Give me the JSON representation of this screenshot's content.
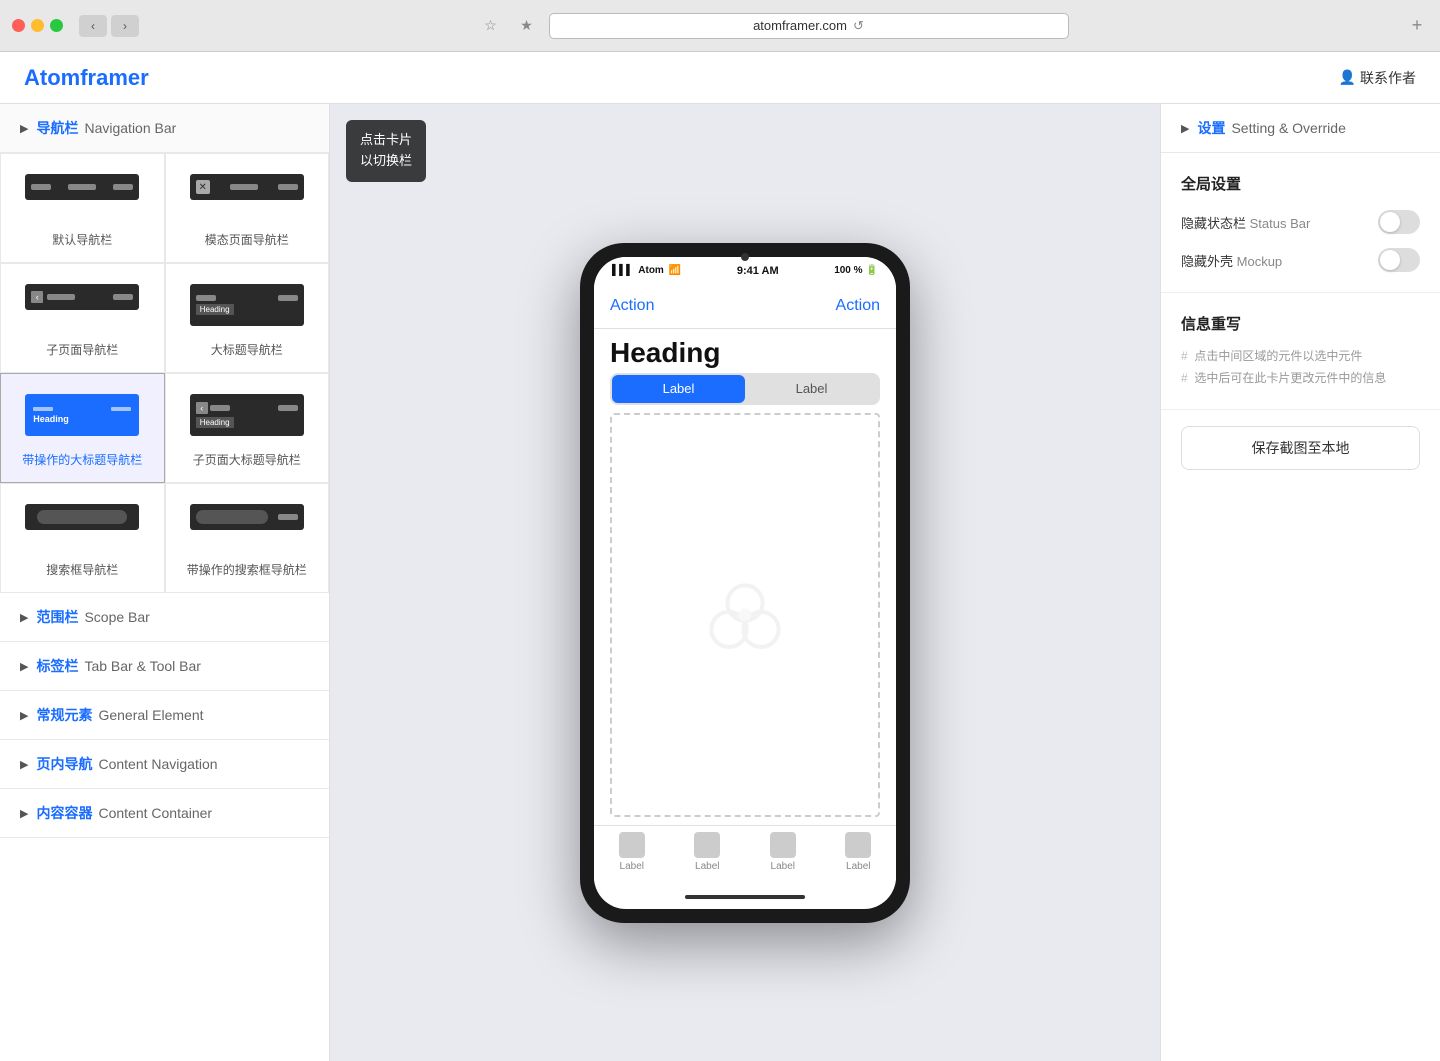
{
  "browser": {
    "url": "atomframer.com",
    "tab_title": "atomframer.com"
  },
  "app": {
    "logo": "Atomframer",
    "contact_label": "联系作者",
    "contact_icon": "👤"
  },
  "tooltip": {
    "line1": "点击卡片",
    "line2": "以切换栏"
  },
  "sidebar": {
    "sections": [
      {
        "id": "navigation-bar",
        "title_cn": "导航栏",
        "title_en": "Navigation Bar",
        "expanded": true
      },
      {
        "id": "scope-bar",
        "title_cn": "范围栏",
        "title_en": "Scope Bar",
        "expanded": false
      },
      {
        "id": "tab-bar",
        "title_cn": "标签栏",
        "title_en": "Tab Bar & Tool Bar",
        "expanded": false
      },
      {
        "id": "general-element",
        "title_cn": "常规元素",
        "title_en": "General Element",
        "expanded": false
      },
      {
        "id": "content-navigation",
        "title_cn": "页内导航",
        "title_en": "Content Navigation",
        "expanded": false
      },
      {
        "id": "content-container",
        "title_cn": "内容容器",
        "title_en": "Content Container",
        "expanded": false
      }
    ],
    "nav_cards": [
      {
        "id": "default-nav",
        "label": "默认导航栏",
        "selected": false
      },
      {
        "id": "modal-nav",
        "label": "模态页面导航栏",
        "selected": false
      },
      {
        "id": "sub-nav",
        "label": "子页面导航栏",
        "selected": false
      },
      {
        "id": "large-title-nav",
        "label": "大标题导航栏",
        "selected": false
      },
      {
        "id": "blue-heading-nav",
        "label": "带操作的大标题导航栏",
        "selected": true,
        "link": true
      },
      {
        "id": "sub-large-title-nav",
        "label": "子页面大标题导航栏",
        "selected": false
      },
      {
        "id": "search-nav",
        "label": "搜索框导航栏",
        "selected": false
      },
      {
        "id": "search-action-nav",
        "label": "带操作的搜索框导航栏",
        "selected": false
      }
    ]
  },
  "phone": {
    "status": {
      "carrier": "Atom",
      "wifi": "◉",
      "time": "9:41 AM",
      "battery": "100 %"
    },
    "navbar": {
      "action_left": "Action",
      "action_right": "Action"
    },
    "heading": "Heading",
    "segment": {
      "label1": "Label",
      "label2": "Label"
    },
    "tab_bar": {
      "items": [
        {
          "label": "Label"
        },
        {
          "label": "Label"
        },
        {
          "label": "Label"
        },
        {
          "label": "Label"
        }
      ]
    }
  },
  "right_panel": {
    "header_title_cn": "设置",
    "header_title_en": "Setting & Override",
    "global_settings": {
      "title": "全局设置",
      "hide_status_bar_cn": "隐藏状态栏",
      "hide_status_bar_en": "Status Bar",
      "hide_mockup_cn": "隐藏外壳",
      "hide_mockup_en": "Mockup"
    },
    "info_rewrite": {
      "title": "信息重写",
      "hint1": "点击中间区域的元件以选中元件",
      "hint2": "选中后可在此卡片更改元件中的信息"
    },
    "save_button_label": "保存截图至本地"
  }
}
